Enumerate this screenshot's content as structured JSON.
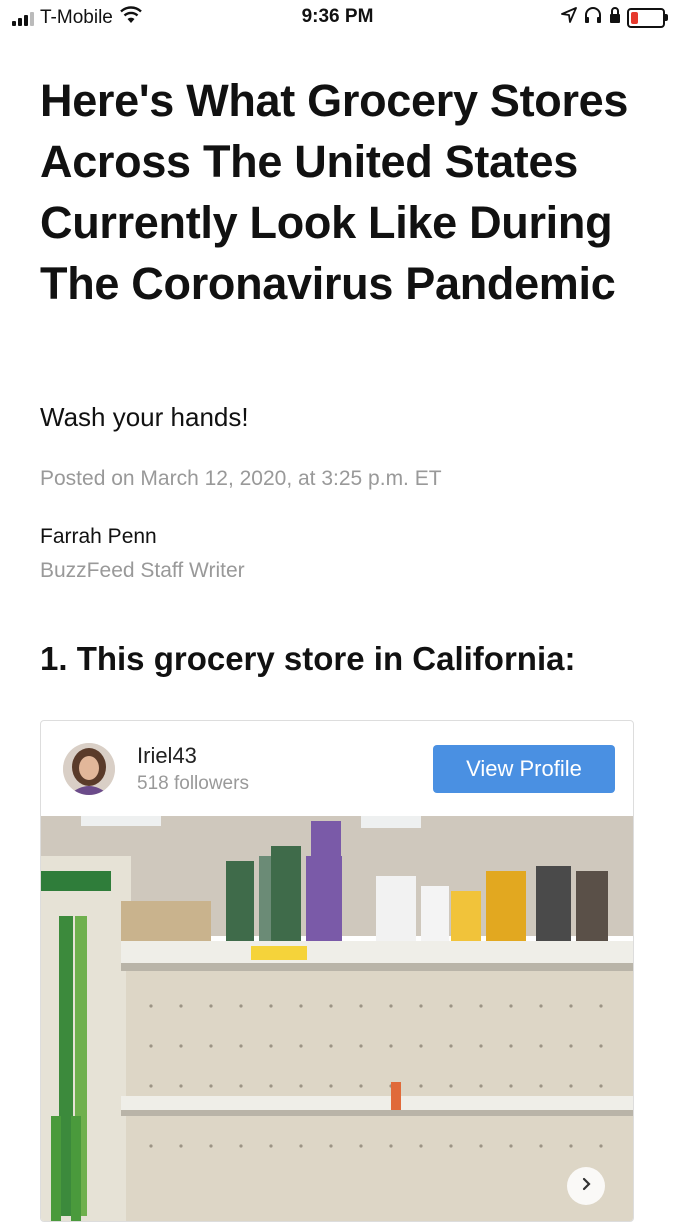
{
  "status_bar": {
    "carrier": "T-Mobile",
    "time": "9:36 PM",
    "icons": [
      "signal-icon",
      "wifi-icon",
      "location-icon",
      "headphones-icon",
      "lock-rotation-icon",
      "battery-icon"
    ],
    "battery_color": "#e63a2e"
  },
  "article": {
    "title": "Here's What Grocery Stores Across The United States Currently Look Like During The Coronavirus Pandemic",
    "dek": "Wash your hands!",
    "posted": "Posted on March 12, 2020, at 3:25 p.m. ET",
    "author_name": "Farrah Penn",
    "author_role": "BuzzFeed Staff Writer",
    "section_title": "1. This grocery store in California:"
  },
  "embed": {
    "username": "Iriel43",
    "followers": "518 followers",
    "view_profile_label": "View Profile",
    "accent_color": "#4a90e2"
  }
}
